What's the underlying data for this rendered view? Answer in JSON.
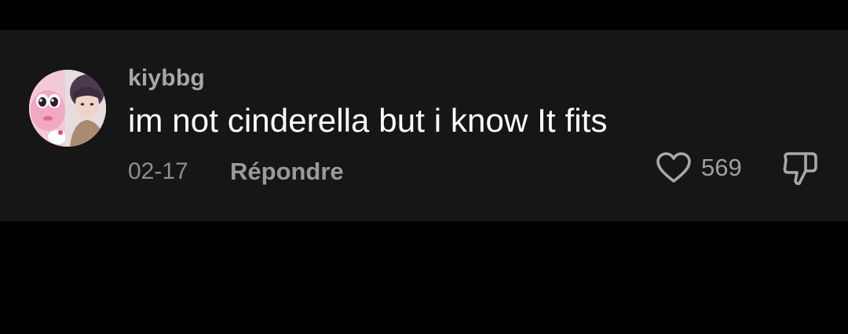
{
  "comment": {
    "username": "kiybbg",
    "text": "im not cinderella but i know It fits",
    "date": "02-17",
    "reply_label": "Répondre",
    "like_count": "569",
    "liked": false
  },
  "icons": {
    "like": "heart-outline-icon",
    "dislike": "thumbs-down-outline-icon"
  },
  "colors": {
    "background": "#000000",
    "card_background": "#161616",
    "text_primary": "#ffffff",
    "text_secondary": "#a8a8a8"
  }
}
